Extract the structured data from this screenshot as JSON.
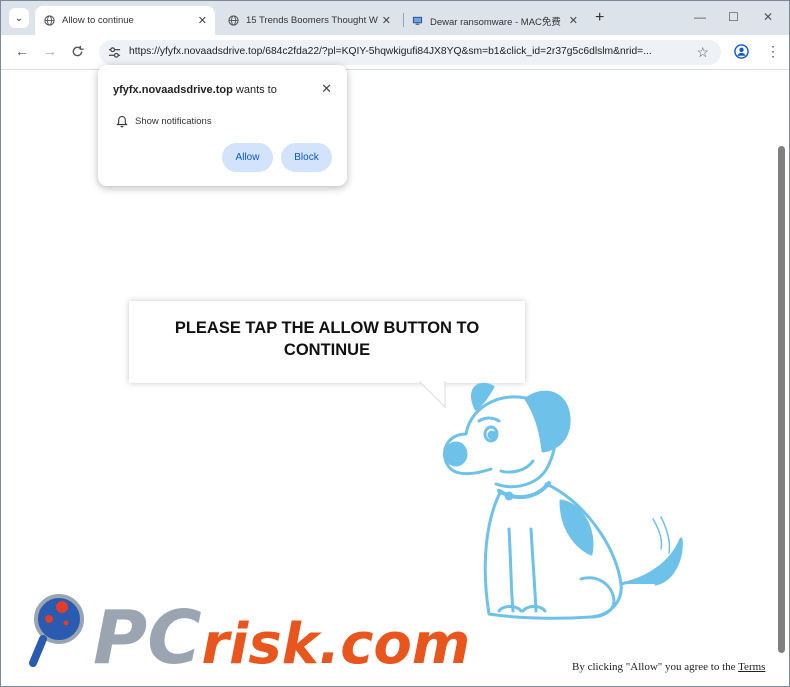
{
  "tabs": [
    {
      "title": "Allow to continue",
      "active": true
    },
    {
      "title": "15 Trends Boomers Thought W",
      "active": false
    },
    {
      "title": "Dewar ransomware - MAC免费",
      "active": false
    }
  ],
  "toolbar": {
    "url": "https://yfyfx.novaadsdrive.top/684c2fda22/?pl=KQIY-5hqwkigufi84JX8YQ&sm=b1&click_id=2r37g5c6dlslm&nrid=..."
  },
  "popup": {
    "site": "yfyfx.novaadsdrive.top",
    "wants_to": " wants to",
    "permission": "Show notifications",
    "allow_label": "Allow",
    "block_label": "Block"
  },
  "page": {
    "message": "PLEASE TAP THE ALLOW BUTTON TO CONTINUE",
    "terms_prefix": "By clicking \"Allow\" you agree to the ",
    "terms_link": "Terms"
  },
  "watermark": {
    "text": "PCrisk.com"
  },
  "colors": {
    "dog": "#6ec1e8",
    "allow_bg": "#d3e3fb",
    "allow_text": "#0b57d0",
    "watermark_red": "#e8551d"
  }
}
